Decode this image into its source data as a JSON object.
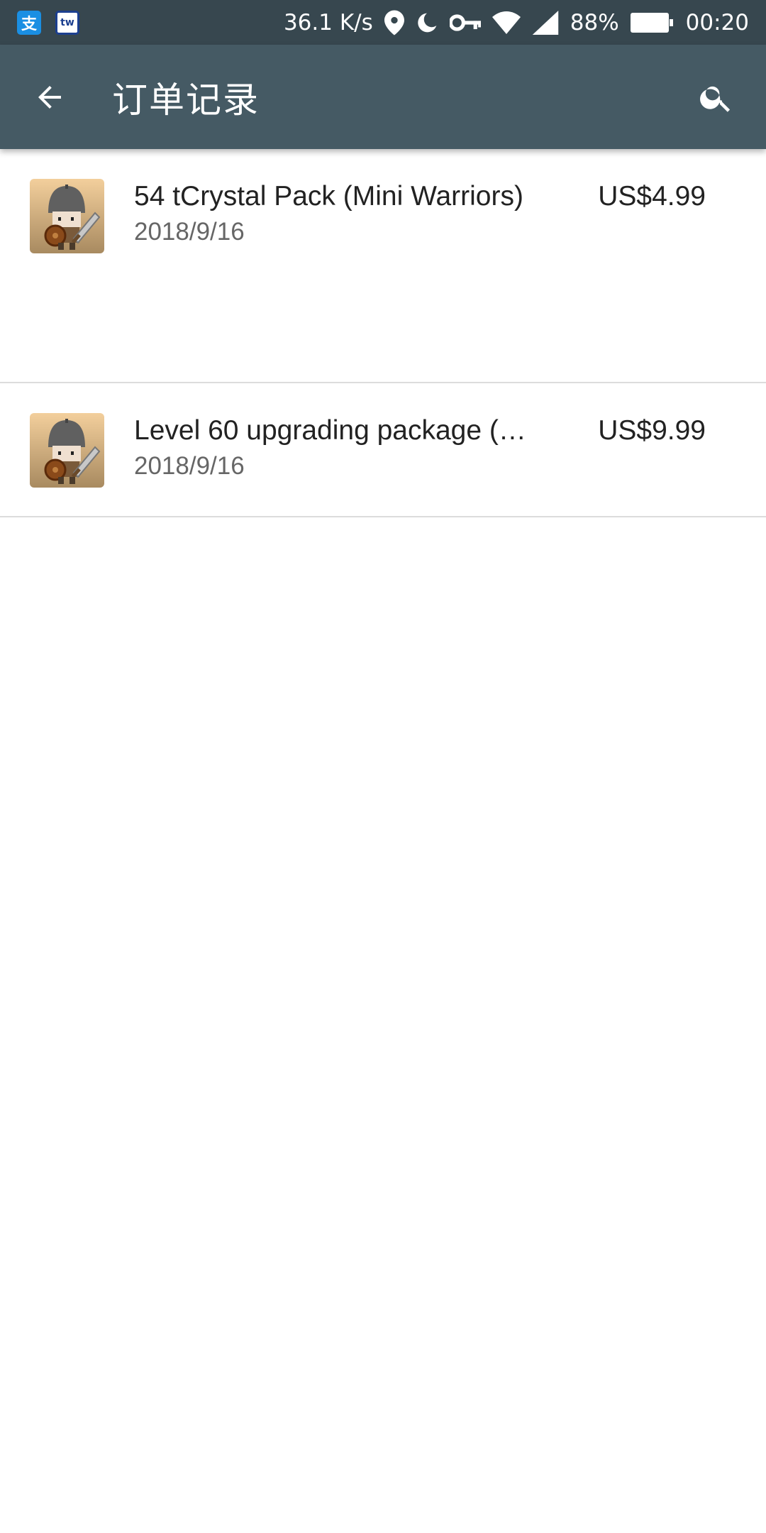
{
  "status_bar": {
    "network_speed": "36.1 K/s",
    "battery_percent": "88%",
    "time": "00:20",
    "left_icons": [
      "alipay-app-icon",
      "notification-app-icon"
    ],
    "right_icons": [
      "location-icon",
      "do-not-disturb-moon-icon",
      "vpn-key-icon",
      "wifi-icon",
      "cellular-signal-icon",
      "battery-icon"
    ],
    "alipay_glyph": "支",
    "other_glyph": "tw"
  },
  "toolbar": {
    "title": "订单记录",
    "back_icon": "arrow-back-icon",
    "search_icon": "search-icon"
  },
  "orders": [
    {
      "name": "54 tCrystal Pack (Mini Warriors)",
      "date": "2018/9/16",
      "price": "US$4.99",
      "thumbnail_icon": "mini-warriors-knight-icon"
    },
    {
      "name": "Level 60 upgrading package (…",
      "date": "2018/9/16",
      "price": "US$9.99",
      "thumbnail_icon": "mini-warriors-knight-icon"
    }
  ],
  "colors": {
    "status_bar_bg": "#37474f",
    "toolbar_bg": "#455a64",
    "divider": "#dcdcdc"
  }
}
